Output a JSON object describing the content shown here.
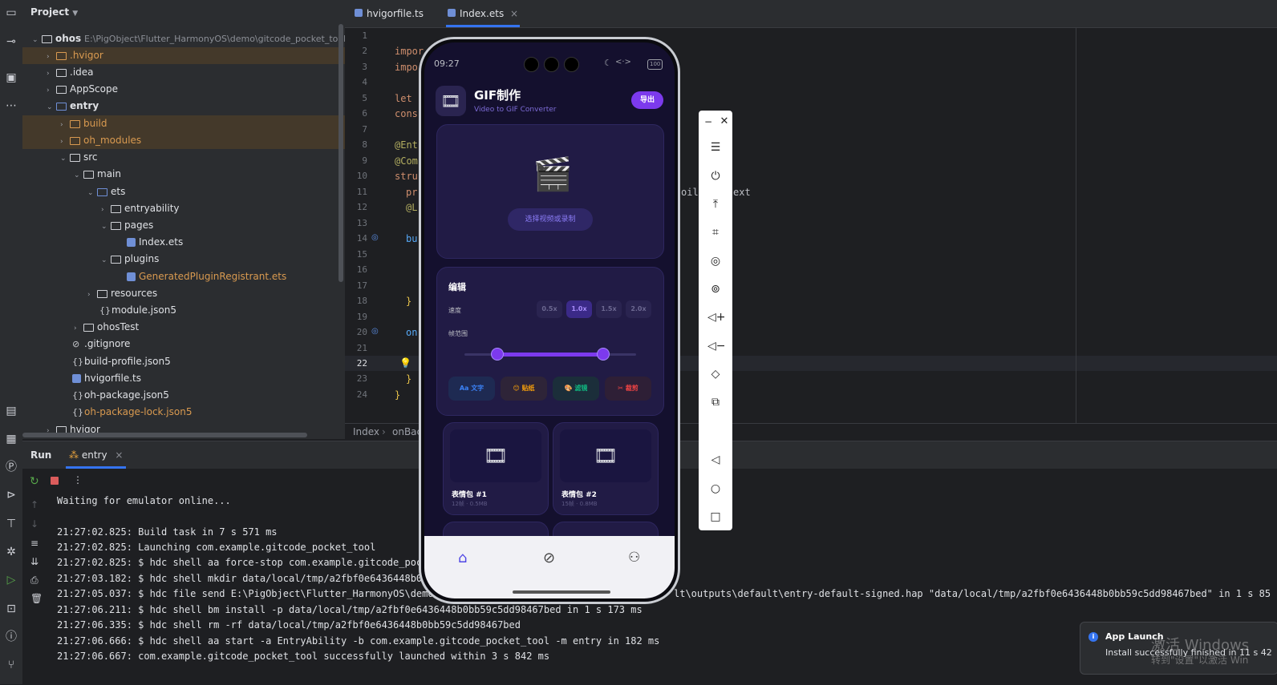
{
  "project": {
    "title": "Project",
    "root_name": "ohos",
    "root_path": "E:\\PigObject\\Flutter_HarmonyOS\\demo\\gitcode_pocket_tool\\oh",
    "items": [
      {
        "label": ".hvigor"
      },
      {
        "label": ".idea"
      },
      {
        "label": "AppScope"
      },
      {
        "label": "entry"
      },
      {
        "label": "build"
      },
      {
        "label": "oh_modules"
      },
      {
        "label": "src"
      },
      {
        "label": "main"
      },
      {
        "label": "ets"
      },
      {
        "label": "entryability"
      },
      {
        "label": "pages"
      },
      {
        "label": "Index.ets"
      },
      {
        "label": "plugins"
      },
      {
        "label": "GeneratedPluginRegistrant.ets"
      },
      {
        "label": "resources"
      },
      {
        "label": "module.json5"
      },
      {
        "label": "ohosTest"
      },
      {
        "label": ".gitignore"
      },
      {
        "label": "build-profile.json5"
      },
      {
        "label": "hvigorfile.ts"
      },
      {
        "label": "oh-package.json5"
      },
      {
        "label": "oh-package-lock.json5"
      },
      {
        "label": "hvigor"
      }
    ]
  },
  "editor": {
    "tabs": [
      {
        "label": "hvigorfile.ts"
      },
      {
        "label": "Index.ets"
      }
    ],
    "line_numbers": [
      "1",
      "2",
      "3",
      "4",
      "5",
      "6",
      "7",
      "8",
      "9",
      "10",
      "11",
      "12",
      "13",
      "14",
      "15",
      "16",
      "17",
      "18",
      "19",
      "20",
      "21",
      "22",
      "23",
      "24"
    ],
    "code_fragments": {
      "l2": "impor",
      "l3": "impo",
      "l5": "let",
      "l6": "cons",
      "l8": "@Ent",
      "l9": "@Com",
      "l10": "stru",
      "l11": "pr",
      "l12": "@L",
      "l14": "bu",
      "l18": "}",
      "l20": "on",
      "l23": "}",
      "l24": "}",
      "right_fragment": "oil",
      "right_fragment2": "ext"
    },
    "breadcrumb": [
      "Index",
      "onBac"
    ]
  },
  "run": {
    "title": "Run",
    "config_tab": "entry",
    "log": [
      "Waiting for emulator online...",
      "",
      "21:27:02.825: Build task in 7 s 571 ms",
      "21:27:02.825: Launching com.example.gitcode_pocket_tool",
      "21:27:02.825: $ hdc shell aa force-stop com.example.gitcode_poc",
      "21:27:03.182: $ hdc shell mkdir data/local/tmp/a2fbf0e6436448b0b",
      "21:27:05.037: $ hdc file send E:\\PigObject\\Flutter_HarmonyOS\\demo",
      "21:27:06.211: $ hdc shell bm install -p data/local/tmp/a2fbf0e6436448b0bb59c5dd98467bed in 1 s 173 ms",
      "21:27:06.335: $ hdc shell rm -rf data/local/tmp/a2fbf0e6436448b0bb59c5dd98467bed",
      "21:27:06.666: $ hdc shell aa start -a EntryAbility -b com.example.gitcode_pocket_tool -m entry in 182 ms",
      "21:27:06.667: com.example.gitcode_pocket_tool successfully launched within 3 s 842 ms"
    ],
    "log_tail_line7": "lt\\outputs\\default\\entry-default-signed.hap \"data/local/tmp/a2fbf0e6436448b0bb59c5dd98467bed\" in 1 s 85"
  },
  "phone": {
    "status_time": "09:27",
    "battery": "100",
    "app_title": "GIF制作",
    "app_subtitle": "Video to GIF Converter",
    "export_label": "导出",
    "select_label": "选择视频或录制",
    "edit_title": "编辑",
    "speed_label": "速度",
    "speeds": [
      "0.5x",
      "1.0x",
      "1.5x",
      "2.0x"
    ],
    "selected_speed": "1.0x",
    "frame_range_label": "帧范围",
    "range_fraction": [
      0.19,
      0.81
    ],
    "tools": [
      {
        "label": "文字",
        "color": "#3b82f6"
      },
      {
        "label": "贴纸",
        "color": "#f59e0b"
      },
      {
        "label": "滤镜",
        "color": "#10b981"
      },
      {
        "label": "裁剪",
        "color": "#ef4444"
      }
    ],
    "gifs": [
      {
        "title": "表情包 #1",
        "meta": "12帧 · 0.5MB"
      },
      {
        "title": "表情包 #2",
        "meta": "15帧 · 0.8MB"
      }
    ],
    "accent": "#7c3aed"
  },
  "notification": {
    "title": "App Launch",
    "body": "Install successfully finished in 11 s 42",
    "watermark1": "激活 Windows",
    "watermark2": "转到\"设置\"以激活 Win"
  }
}
